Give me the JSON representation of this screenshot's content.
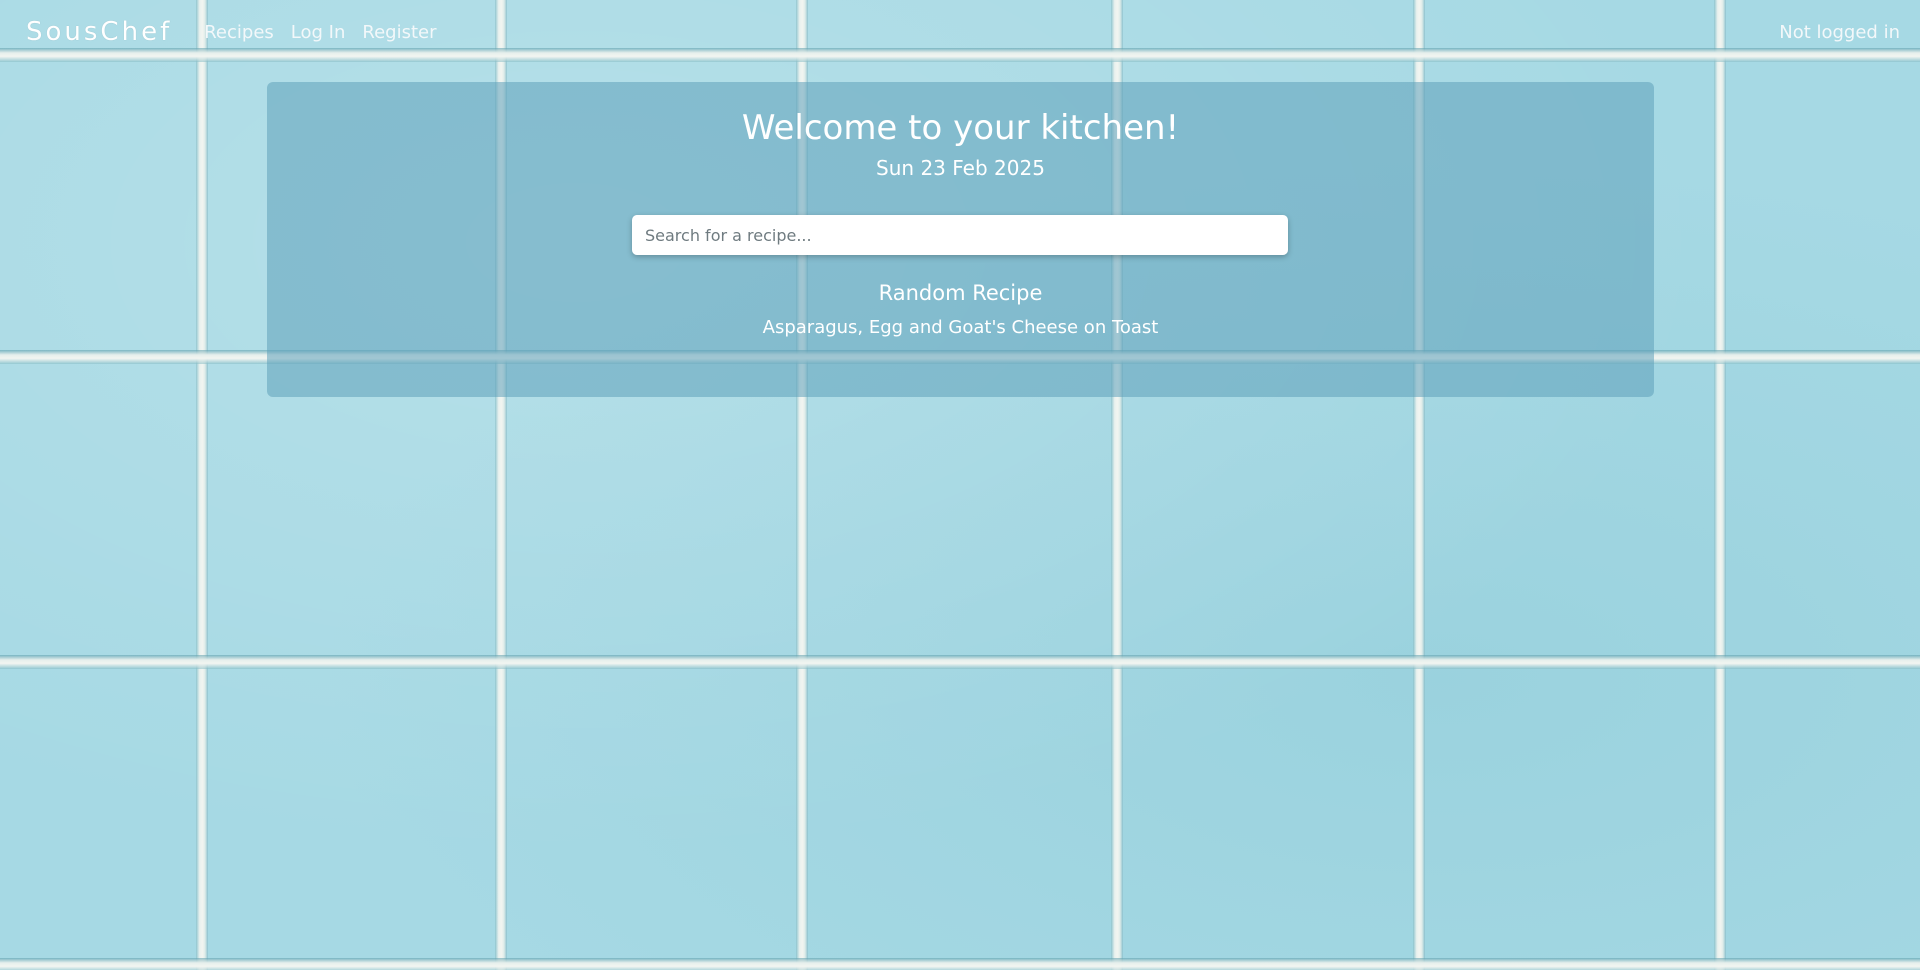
{
  "nav": {
    "brand": "SousChef",
    "links": [
      "Recipes",
      "Log In",
      "Register"
    ],
    "status": "Not logged in"
  },
  "main": {
    "title": "Welcome to your kitchen!",
    "date": "Sun 23 Feb 2025",
    "search_placeholder": "Search for a recipe...",
    "random_heading": "Random Recipe",
    "random_recipe": "Asparagus, Egg and Goat's Cheese on Toast"
  },
  "colors": {
    "tile": "#a6d9e4",
    "grout": "#f2f5f1",
    "panel_overlay": "#5fa0b9"
  }
}
